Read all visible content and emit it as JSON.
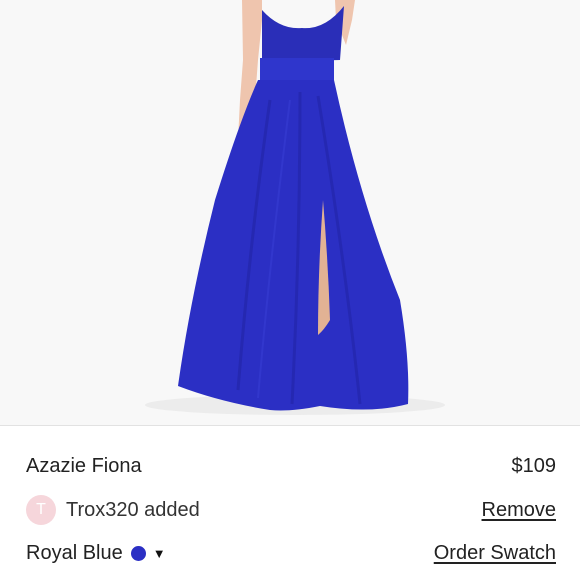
{
  "product": {
    "image_alt": "Royal blue strapless chiffon gown",
    "title": "Azazie Fiona",
    "price": "$109"
  },
  "bundle": {
    "avatar_initial": "T",
    "added_text": "Trox320 added",
    "remove_label": "Remove"
  },
  "variant": {
    "color_name": "Royal Blue",
    "color_hex": "#2b2fc4",
    "dropdown_icon": "caret-down-icon",
    "swatch_label": "Order Swatch"
  },
  "colors": {
    "avatar_bg": "#f6d6db",
    "dress": "#2b2fc4"
  }
}
